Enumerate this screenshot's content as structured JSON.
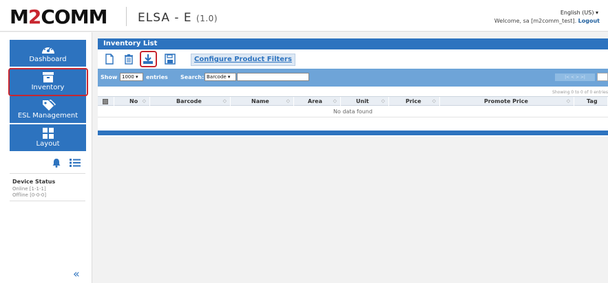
{
  "header": {
    "logo_pre": "M",
    "logo_two": "2",
    "logo_post": "COMM",
    "app_title": "ELSA - E",
    "app_version": "(1.0)",
    "language": "English (US) ▾",
    "welcome_text": "Welcome, sa [m2comm_test]. ",
    "logout_label": "Logout"
  },
  "sidebar": {
    "items": [
      {
        "label": "Dashboard",
        "icon": "dashboard-gauge-icon"
      },
      {
        "label": "Inventory",
        "icon": "inventory-box-icon"
      },
      {
        "label": "ESL Management",
        "icon": "tags-icon"
      },
      {
        "label": "Layout",
        "icon": "layout-grid-icon"
      }
    ],
    "notification_icon": "bell-icon",
    "list_icon": "list-icon",
    "device_status": {
      "title": "Device Status",
      "online": "Online [1-1-1]",
      "offline": "Offline [0-0-0]"
    },
    "collapse_glyph": "«"
  },
  "main": {
    "panel_title": "Inventory List",
    "toolbar": {
      "new_icon": "new-document-icon",
      "delete_icon": "trash-icon",
      "export_icon": "download-icon",
      "save_icon": "floppy-disk-icon",
      "configure_label": "Configure Product Filters"
    },
    "filter": {
      "show_label": "Show",
      "show_value": "1000 ▾",
      "entries_label": "entries",
      "search_label": "Search:",
      "search_field_value": "Barcode ▾",
      "search_text": "",
      "pager_text": "|<  <  >  >|",
      "showing_text": "Showing 0 to 0 of 0 entries"
    },
    "table": {
      "columns": [
        "No",
        "Barcode",
        "Name",
        "Area",
        "Unit",
        "Price",
        "Promote Price",
        "Tag"
      ],
      "sort_glyph": "◇",
      "empty_text": "No data found",
      "rows": []
    }
  },
  "colors": {
    "brand_blue": "#2d73bf",
    "brand_red": "#c8262f",
    "filter_bar": "#6ea4d8",
    "highlight": "#c8262f"
  }
}
